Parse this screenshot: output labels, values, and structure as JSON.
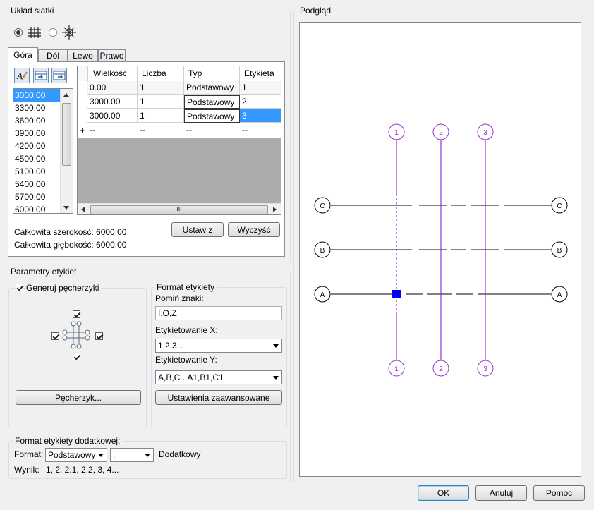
{
  "grid_layout": {
    "title": "Układ siatki",
    "tabs": [
      "Góra",
      "Dół",
      "Lewo",
      "Prawo"
    ],
    "active_tab": 0,
    "spacing_values": [
      "3000.00",
      "3300.00",
      "3600.00",
      "3900.00",
      "4200.00",
      "4500.00",
      "5100.00",
      "5400.00",
      "5700.00",
      "6000.00"
    ],
    "selected_value_index": 0,
    "table": {
      "headers": [
        "Wielkość",
        "Liczba",
        "Typ",
        "Etykieta"
      ],
      "rows": [
        [
          "0.00",
          "1",
          "Podstawowy",
          "1"
        ],
        [
          "3000.00",
          "1",
          "Podstawowy",
          "2"
        ],
        [
          "3000.00",
          "1",
          "Podstawowy",
          "3"
        ],
        [
          "--",
          "--",
          "--",
          "--"
        ]
      ],
      "new_row_marker": "+",
      "scroll_marker": "III"
    },
    "total_width_label": "Całkowita szerokość: 6000.00",
    "total_depth_label": "Całkowita głębokość: 6000.00",
    "set_button": "Ustaw z",
    "clear_button": "Wyczyść"
  },
  "label_params": {
    "title": "Parametry etykiet",
    "generate_bubbles": "Generuj pęcherzyki",
    "bubble_button": "Pęcherzyk...",
    "format_title": "Format etykiety",
    "omit_chars_label": "Pomiń znaki:",
    "omit_chars_value": "I,O,Z",
    "label_x": "Etykietowanie X:",
    "label_x_value": "1,2,3...",
    "label_y": "Etykietowanie Y:",
    "label_y_value": "A,B,C...A1,B1,C1",
    "advanced_button": "Ustawienia zaawansowane"
  },
  "extra_format": {
    "title": "Format etykiety dodatkowej:",
    "format_label": "Format:",
    "format_value": "Podstawowy",
    "separator_value": ".",
    "extra_label": "Dodatkowy",
    "result_label": "Wynik:",
    "result_value": "1, 2, 2.1, 2.2, 3, 4..."
  },
  "preview": {
    "title": "Podgląd",
    "columns": [
      "1",
      "2",
      "3"
    ],
    "rows": [
      "C",
      "B",
      "A"
    ]
  },
  "footer": {
    "ok": "OK",
    "cancel": "Anuluj",
    "help": "Pomoc"
  },
  "colors": {
    "column_line": "#9b30d0",
    "row_line": "#000000",
    "marker": "#0000ff",
    "selection": "#3399ff"
  }
}
